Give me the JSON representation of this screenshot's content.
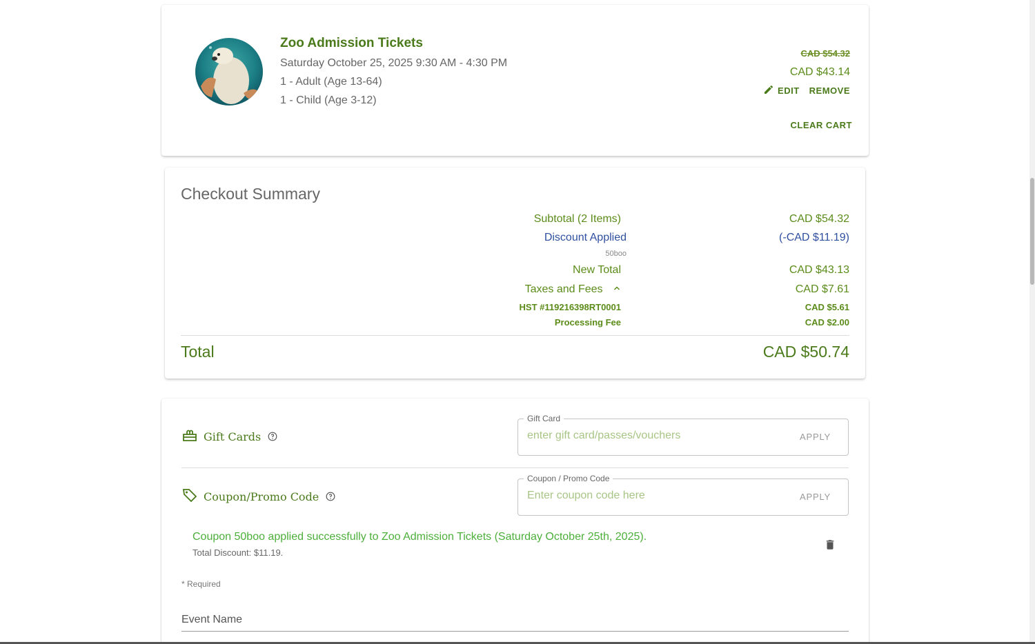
{
  "cart": {
    "item_title": "Zoo Admission Tickets",
    "item_date": "Saturday October 25, 2025 9:30 AM - 4:30 PM",
    "item_lines": [
      "1 - Adult (Age 13-64)",
      "1 - Child (Age 3-12)"
    ],
    "original_price": "CAD $54.32",
    "price": "CAD $43.14",
    "edit_label": "EDIT",
    "remove_label": "REMOVE",
    "clear_cart_label": "CLEAR CART"
  },
  "summary": {
    "title": "Checkout Summary",
    "subtotal_label": "Subtotal (2 Items)",
    "subtotal_value": "CAD $54.32",
    "discount_label": "Discount Applied",
    "discount_value": "(-CAD $11.19)",
    "discount_code": "50boo",
    "new_total_label": "New Total",
    "new_total_value": "CAD $43.13",
    "taxes_label": "Taxes and Fees",
    "taxes_value": "CAD $7.61",
    "hst_label": "HST #119216398RT0001",
    "hst_value": "CAD $5.61",
    "processing_label": "Processing Fee",
    "processing_value": "CAD $2.00",
    "total_label": "Total",
    "total_value": "CAD $50.74"
  },
  "payment": {
    "gift_cards_label": "Gift Cards",
    "gift_card_field_label": "Gift Card",
    "gift_card_placeholder": "enter gift card/passes/vouchers",
    "coupon_label": "Coupon/Promo Code",
    "coupon_field_label": "Coupon / Promo Code",
    "coupon_placeholder": "Enter coupon code here",
    "apply_label": "APPLY",
    "coupon_message": "Coupon 50boo applied successfully to Zoo Admission Tickets (Saturday October 25th, 2025).",
    "coupon_discount": "Total Discount: $11.19.",
    "required_note": "* Required",
    "event_name_label": "Event Name"
  },
  "colors": {
    "brand_green": "#4a7a1a",
    "price_green": "#5b8c1a",
    "discount_blue": "#2f4fa0",
    "success_green": "#4caf3a"
  },
  "icons": [
    "polar-bear-photo",
    "pencil-icon",
    "chevron-up-icon",
    "gift-icon",
    "help-circle-icon",
    "tag-icon",
    "trash-icon"
  ]
}
